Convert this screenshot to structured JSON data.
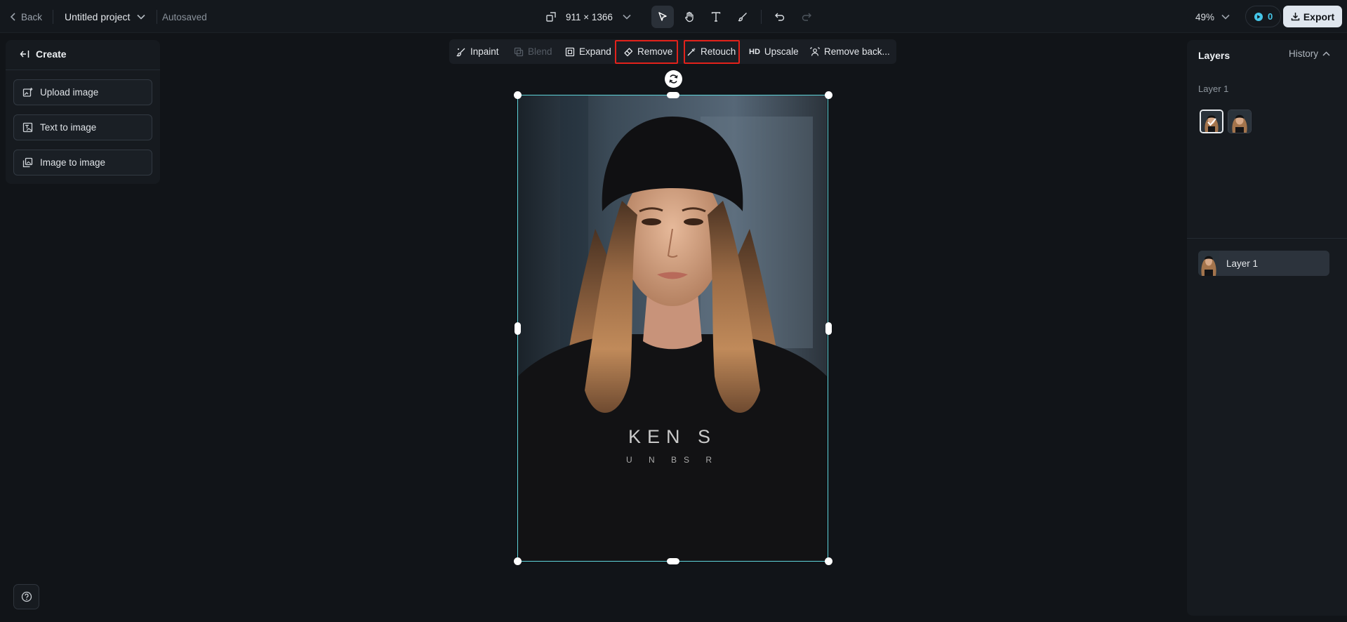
{
  "header": {
    "back_label": "Back",
    "project_name": "Untitled project",
    "save_status": "Autosaved",
    "canvas_size": "911 × 1366",
    "zoom": "49%",
    "credits": "0",
    "export_label": "Export"
  },
  "tools": [
    "select-tool",
    "hand-tool",
    "text-tool",
    "brush-tool",
    "undo",
    "redo"
  ],
  "left_panel": {
    "title": "Create",
    "items": [
      {
        "label": "Upload image",
        "icon": "upload-image-icon"
      },
      {
        "label": "Text to image",
        "icon": "text-to-image-icon"
      },
      {
        "label": "Image to image",
        "icon": "image-to-image-icon"
      }
    ]
  },
  "edit_toolbar": {
    "inpaint": "Inpaint",
    "blend": "Blend",
    "expand": "Expand",
    "remove": "Remove",
    "retouch": "Retouch",
    "upscale_badge": "HD",
    "upscale": "Upscale",
    "remove_background": "Remove back..."
  },
  "canvas": {
    "shirt_line1": "KEN S",
    "shirt_line2": "U N BS R"
  },
  "right_panel": {
    "title": "Layers",
    "history_label": "History",
    "group_label": "Layer 1",
    "layer_name": "Layer 1"
  },
  "colors": {
    "background": "#111418",
    "selection": "#5fd3d9",
    "highlight": "#e3221b",
    "credits_accent": "#45c6e8",
    "export_bg": "#dfe6ee"
  }
}
